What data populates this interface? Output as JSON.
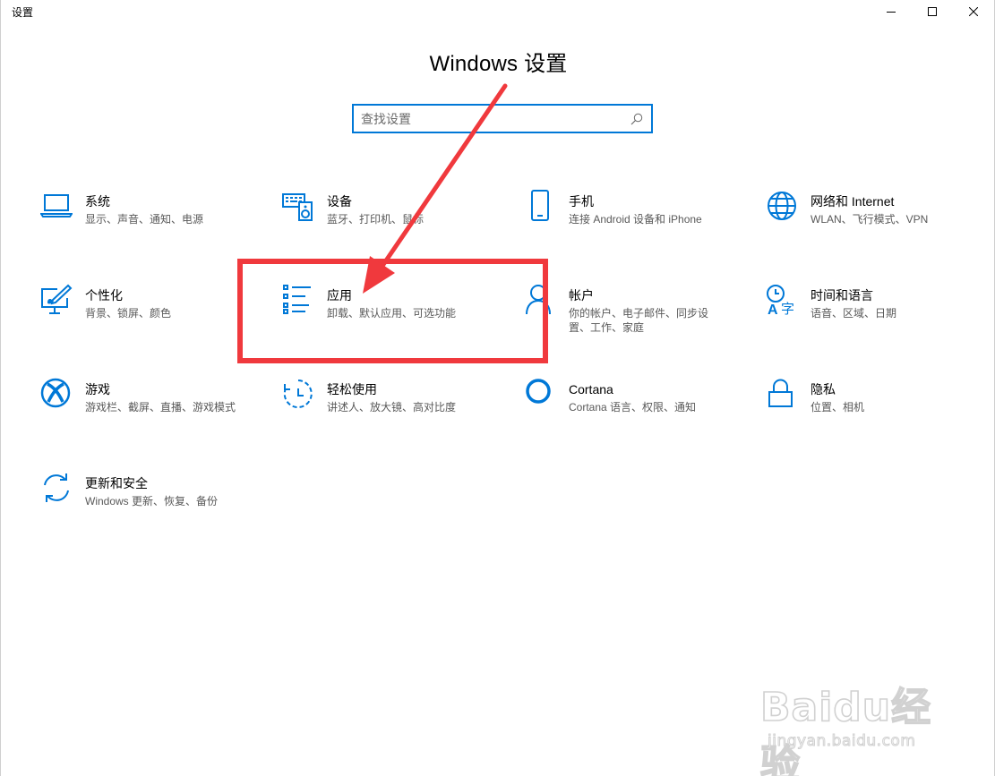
{
  "window": {
    "title": "设置",
    "controls": [
      "minimize",
      "maximize",
      "close"
    ]
  },
  "heading": "Windows 设置",
  "search": {
    "placeholder": "查找设置",
    "value": ""
  },
  "tiles": [
    {
      "id": "system",
      "title": "系统",
      "desc": "显示、声音、通知、电源",
      "icon": "laptop-icon"
    },
    {
      "id": "devices",
      "title": "设备",
      "desc": "蓝牙、打印机、鼠标",
      "icon": "keyboard-speaker-icon"
    },
    {
      "id": "phone",
      "title": "手机",
      "desc": "连接 Android 设备和 iPhone",
      "icon": "phone-icon"
    },
    {
      "id": "network",
      "title": "网络和 Internet",
      "desc": "WLAN、飞行模式、VPN",
      "icon": "globe-icon"
    },
    {
      "id": "personalization",
      "title": "个性化",
      "desc": "背景、锁屏、颜色",
      "icon": "paint-monitor-icon"
    },
    {
      "id": "apps",
      "title": "应用",
      "desc": "卸载、默认应用、可选功能",
      "icon": "list-icon"
    },
    {
      "id": "accounts",
      "title": "帐户",
      "desc": "你的帐户、电子邮件、同步设置、工作、家庭",
      "icon": "person-icon"
    },
    {
      "id": "time-language",
      "title": "时间和语言",
      "desc": "语音、区域、日期",
      "icon": "time-language-icon"
    },
    {
      "id": "gaming",
      "title": "游戏",
      "desc": "游戏栏、截屏、直播、游戏模式",
      "icon": "xbox-icon"
    },
    {
      "id": "ease-of-access",
      "title": "轻松使用",
      "desc": "讲述人、放大镜、高对比度",
      "icon": "ease-of-access-icon"
    },
    {
      "id": "cortana",
      "title": "Cortana",
      "desc": "Cortana 语言、权限、通知",
      "icon": "cortana-ring-icon"
    },
    {
      "id": "privacy",
      "title": "隐私",
      "desc": "位置、相机",
      "icon": "lock-icon"
    },
    {
      "id": "update-security",
      "title": "更新和安全",
      "desc": "Windows 更新、恢复、备份",
      "icon": "sync-icon"
    }
  ],
  "annotation": {
    "color": "#f0393d",
    "highlighted_tile": "apps"
  },
  "watermark": {
    "brand": "Baidu经验",
    "url": "jingyan.baidu.com"
  },
  "colors": {
    "accent": "#0078d7",
    "annotation": "#f0393d"
  }
}
